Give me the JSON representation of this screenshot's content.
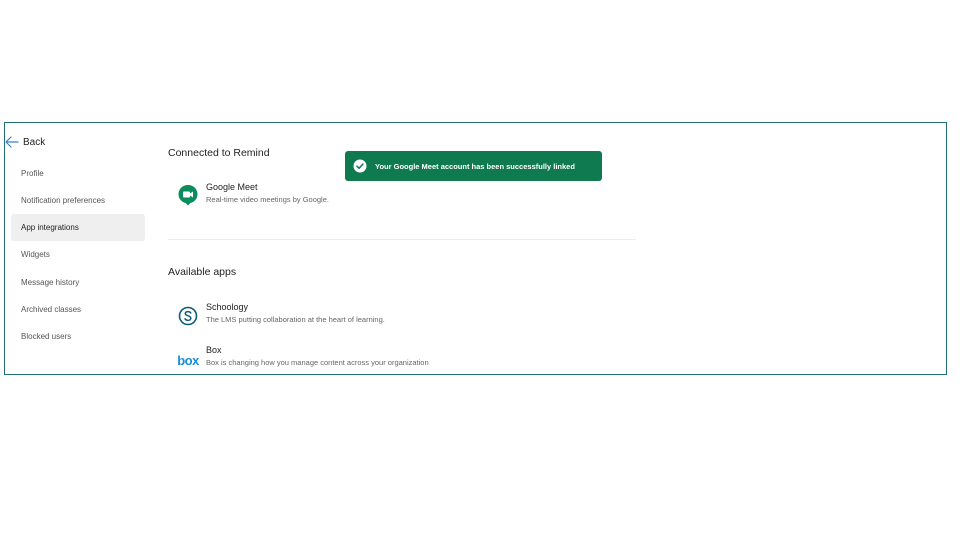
{
  "sidebar": {
    "back_label": "Back",
    "items": [
      {
        "label": "Profile"
      },
      {
        "label": "Notification preferences"
      },
      {
        "label": "App integrations"
      },
      {
        "label": "Widgets"
      },
      {
        "label": "Message history"
      },
      {
        "label": "Archived classes"
      },
      {
        "label": "Blocked users"
      }
    ],
    "active_item": "App integrations"
  },
  "main": {
    "connected": {
      "title": "Connected to Remind",
      "apps": [
        {
          "name": "Google Meet",
          "description": "Real-time video meetings by Google.",
          "icon": "google-meet-icon"
        }
      ]
    },
    "available": {
      "title": "Available apps",
      "apps": [
        {
          "name": "Schoology",
          "description": "The LMS putting collaboration at the heart of learning.",
          "icon": "schoology-icon"
        },
        {
          "name": "Box",
          "description": "Box is changing how you manage content across your organization",
          "icon": "box-logo",
          "logo_text": "box"
        }
      ]
    }
  },
  "toast": {
    "message": "Your Google Meet account has been successfully linked",
    "icon": "check-circle-icon"
  },
  "colors": {
    "frame_border": "#1f6e78",
    "toast_bg": "#0f7a4f",
    "active_nav_bg": "#efefef",
    "back_arrow": "#3a82c4",
    "meet_green": "#0a8c5c",
    "schoology_blue": "#0b5d7a",
    "box_blue": "#1a8fd8"
  }
}
